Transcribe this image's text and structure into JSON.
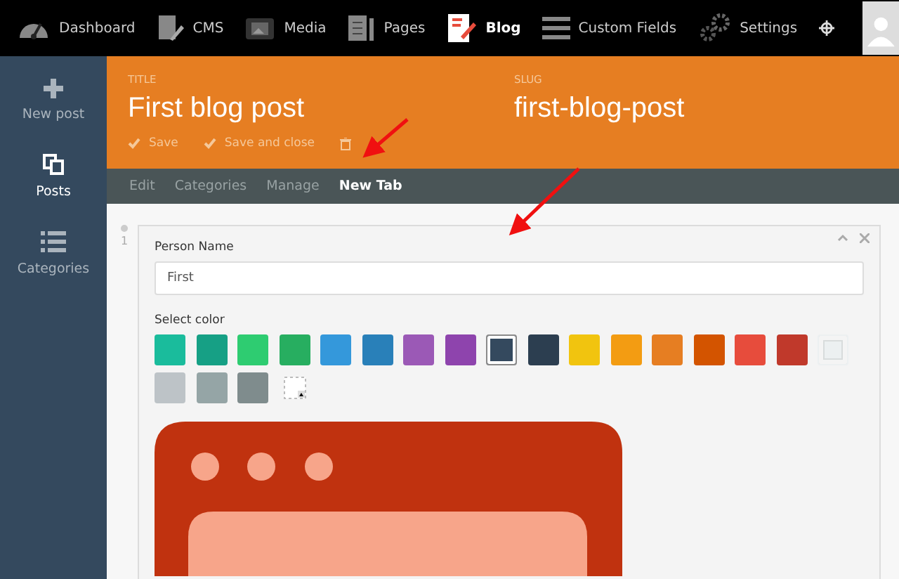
{
  "top_nav": {
    "items": [
      {
        "label": "Dashboard",
        "selected": false
      },
      {
        "label": "CMS",
        "selected": false
      },
      {
        "label": "Media",
        "selected": false
      },
      {
        "label": "Pages",
        "selected": false
      },
      {
        "label": "Blog",
        "selected": true
      },
      {
        "label": "Custom Fields",
        "selected": false
      },
      {
        "label": "Settings",
        "selected": false
      }
    ]
  },
  "sidebar": {
    "items": [
      {
        "label": "New post",
        "selected": false
      },
      {
        "label": "Posts",
        "selected": true
      },
      {
        "label": "Categories",
        "selected": false
      }
    ]
  },
  "header": {
    "title_label": "TITLE",
    "title": "First blog post",
    "slug_label": "SLUG",
    "slug": "first-blog-post",
    "actions": [
      "Save",
      "Save and close"
    ]
  },
  "tabs": [
    {
      "label": "Edit",
      "selected": false
    },
    {
      "label": "Categories",
      "selected": false
    },
    {
      "label": "Manage",
      "selected": false
    },
    {
      "label": "New Tab",
      "selected": true
    }
  ],
  "item": {
    "row_number": "1",
    "person_name": {
      "label": "Person Name",
      "value": "First"
    },
    "color_field": {
      "label": "Select color",
      "swatches": [
        {
          "color": "#1abc9c",
          "selected": false
        },
        {
          "color": "#16a085",
          "selected": false
        },
        {
          "color": "#2ecc71",
          "selected": false
        },
        {
          "color": "#27ae60",
          "selected": false
        },
        {
          "color": "#3498db",
          "selected": false
        },
        {
          "color": "#2980b9",
          "selected": false
        },
        {
          "color": "#9b59b6",
          "selected": false
        },
        {
          "color": "#8e44ad",
          "selected": false
        },
        {
          "color": "#34495e",
          "selected": true
        },
        {
          "color": "#2c3e50",
          "selected": false
        },
        {
          "color": "#f1c40f",
          "selected": false
        },
        {
          "color": "#f39c12",
          "selected": false
        },
        {
          "color": "#e67e22",
          "selected": false
        },
        {
          "color": "#d35400",
          "selected": false
        },
        {
          "color": "#e74c3c",
          "selected": false
        },
        {
          "color": "#c0392b",
          "selected": false
        },
        {
          "color": "#ecf0f1",
          "selected": false
        },
        {
          "color": "#bdc3c7",
          "selected": false
        },
        {
          "color": "#95a5a6",
          "selected": false
        },
        {
          "color": "#7f8c8d",
          "selected": false
        }
      ]
    }
  }
}
